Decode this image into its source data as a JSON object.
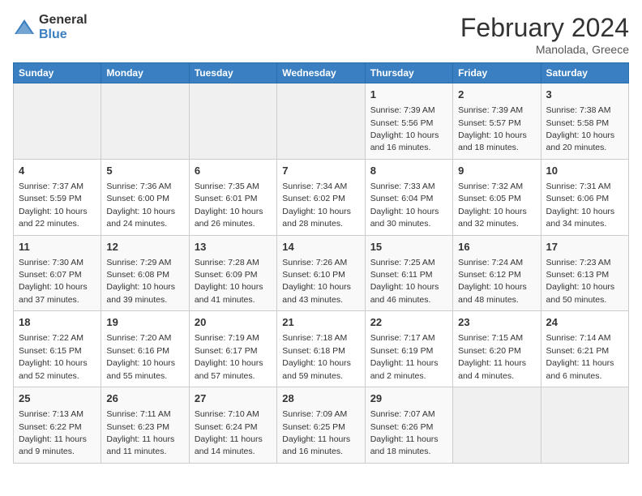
{
  "header": {
    "logo_general": "General",
    "logo_blue": "Blue",
    "title": "February 2024",
    "subtitle": "Manolada, Greece"
  },
  "calendar": {
    "days_of_week": [
      "Sunday",
      "Monday",
      "Tuesday",
      "Wednesday",
      "Thursday",
      "Friday",
      "Saturday"
    ],
    "weeks": [
      [
        {
          "day": "",
          "info": ""
        },
        {
          "day": "",
          "info": ""
        },
        {
          "day": "",
          "info": ""
        },
        {
          "day": "",
          "info": ""
        },
        {
          "day": "1",
          "info": "Sunrise: 7:39 AM\nSunset: 5:56 PM\nDaylight: 10 hours\nand 16 minutes."
        },
        {
          "day": "2",
          "info": "Sunrise: 7:39 AM\nSunset: 5:57 PM\nDaylight: 10 hours\nand 18 minutes."
        },
        {
          "day": "3",
          "info": "Sunrise: 7:38 AM\nSunset: 5:58 PM\nDaylight: 10 hours\nand 20 minutes."
        }
      ],
      [
        {
          "day": "4",
          "info": "Sunrise: 7:37 AM\nSunset: 5:59 PM\nDaylight: 10 hours\nand 22 minutes."
        },
        {
          "day": "5",
          "info": "Sunrise: 7:36 AM\nSunset: 6:00 PM\nDaylight: 10 hours\nand 24 minutes."
        },
        {
          "day": "6",
          "info": "Sunrise: 7:35 AM\nSunset: 6:01 PM\nDaylight: 10 hours\nand 26 minutes."
        },
        {
          "day": "7",
          "info": "Sunrise: 7:34 AM\nSunset: 6:02 PM\nDaylight: 10 hours\nand 28 minutes."
        },
        {
          "day": "8",
          "info": "Sunrise: 7:33 AM\nSunset: 6:04 PM\nDaylight: 10 hours\nand 30 minutes."
        },
        {
          "day": "9",
          "info": "Sunrise: 7:32 AM\nSunset: 6:05 PM\nDaylight: 10 hours\nand 32 minutes."
        },
        {
          "day": "10",
          "info": "Sunrise: 7:31 AM\nSunset: 6:06 PM\nDaylight: 10 hours\nand 34 minutes."
        }
      ],
      [
        {
          "day": "11",
          "info": "Sunrise: 7:30 AM\nSunset: 6:07 PM\nDaylight: 10 hours\nand 37 minutes."
        },
        {
          "day": "12",
          "info": "Sunrise: 7:29 AM\nSunset: 6:08 PM\nDaylight: 10 hours\nand 39 minutes."
        },
        {
          "day": "13",
          "info": "Sunrise: 7:28 AM\nSunset: 6:09 PM\nDaylight: 10 hours\nand 41 minutes."
        },
        {
          "day": "14",
          "info": "Sunrise: 7:26 AM\nSunset: 6:10 PM\nDaylight: 10 hours\nand 43 minutes."
        },
        {
          "day": "15",
          "info": "Sunrise: 7:25 AM\nSunset: 6:11 PM\nDaylight: 10 hours\nand 46 minutes."
        },
        {
          "day": "16",
          "info": "Sunrise: 7:24 AM\nSunset: 6:12 PM\nDaylight: 10 hours\nand 48 minutes."
        },
        {
          "day": "17",
          "info": "Sunrise: 7:23 AM\nSunset: 6:13 PM\nDaylight: 10 hours\nand 50 minutes."
        }
      ],
      [
        {
          "day": "18",
          "info": "Sunrise: 7:22 AM\nSunset: 6:15 PM\nDaylight: 10 hours\nand 52 minutes."
        },
        {
          "day": "19",
          "info": "Sunrise: 7:20 AM\nSunset: 6:16 PM\nDaylight: 10 hours\nand 55 minutes."
        },
        {
          "day": "20",
          "info": "Sunrise: 7:19 AM\nSunset: 6:17 PM\nDaylight: 10 hours\nand 57 minutes."
        },
        {
          "day": "21",
          "info": "Sunrise: 7:18 AM\nSunset: 6:18 PM\nDaylight: 10 hours\nand 59 minutes."
        },
        {
          "day": "22",
          "info": "Sunrise: 7:17 AM\nSunset: 6:19 PM\nDaylight: 11 hours\nand 2 minutes."
        },
        {
          "day": "23",
          "info": "Sunrise: 7:15 AM\nSunset: 6:20 PM\nDaylight: 11 hours\nand 4 minutes."
        },
        {
          "day": "24",
          "info": "Sunrise: 7:14 AM\nSunset: 6:21 PM\nDaylight: 11 hours\nand 6 minutes."
        }
      ],
      [
        {
          "day": "25",
          "info": "Sunrise: 7:13 AM\nSunset: 6:22 PM\nDaylight: 11 hours\nand 9 minutes."
        },
        {
          "day": "26",
          "info": "Sunrise: 7:11 AM\nSunset: 6:23 PM\nDaylight: 11 hours\nand 11 minutes."
        },
        {
          "day": "27",
          "info": "Sunrise: 7:10 AM\nSunset: 6:24 PM\nDaylight: 11 hours\nand 14 minutes."
        },
        {
          "day": "28",
          "info": "Sunrise: 7:09 AM\nSunset: 6:25 PM\nDaylight: 11 hours\nand 16 minutes."
        },
        {
          "day": "29",
          "info": "Sunrise: 7:07 AM\nSunset: 6:26 PM\nDaylight: 11 hours\nand 18 minutes."
        },
        {
          "day": "",
          "info": ""
        },
        {
          "day": "",
          "info": ""
        }
      ]
    ]
  }
}
